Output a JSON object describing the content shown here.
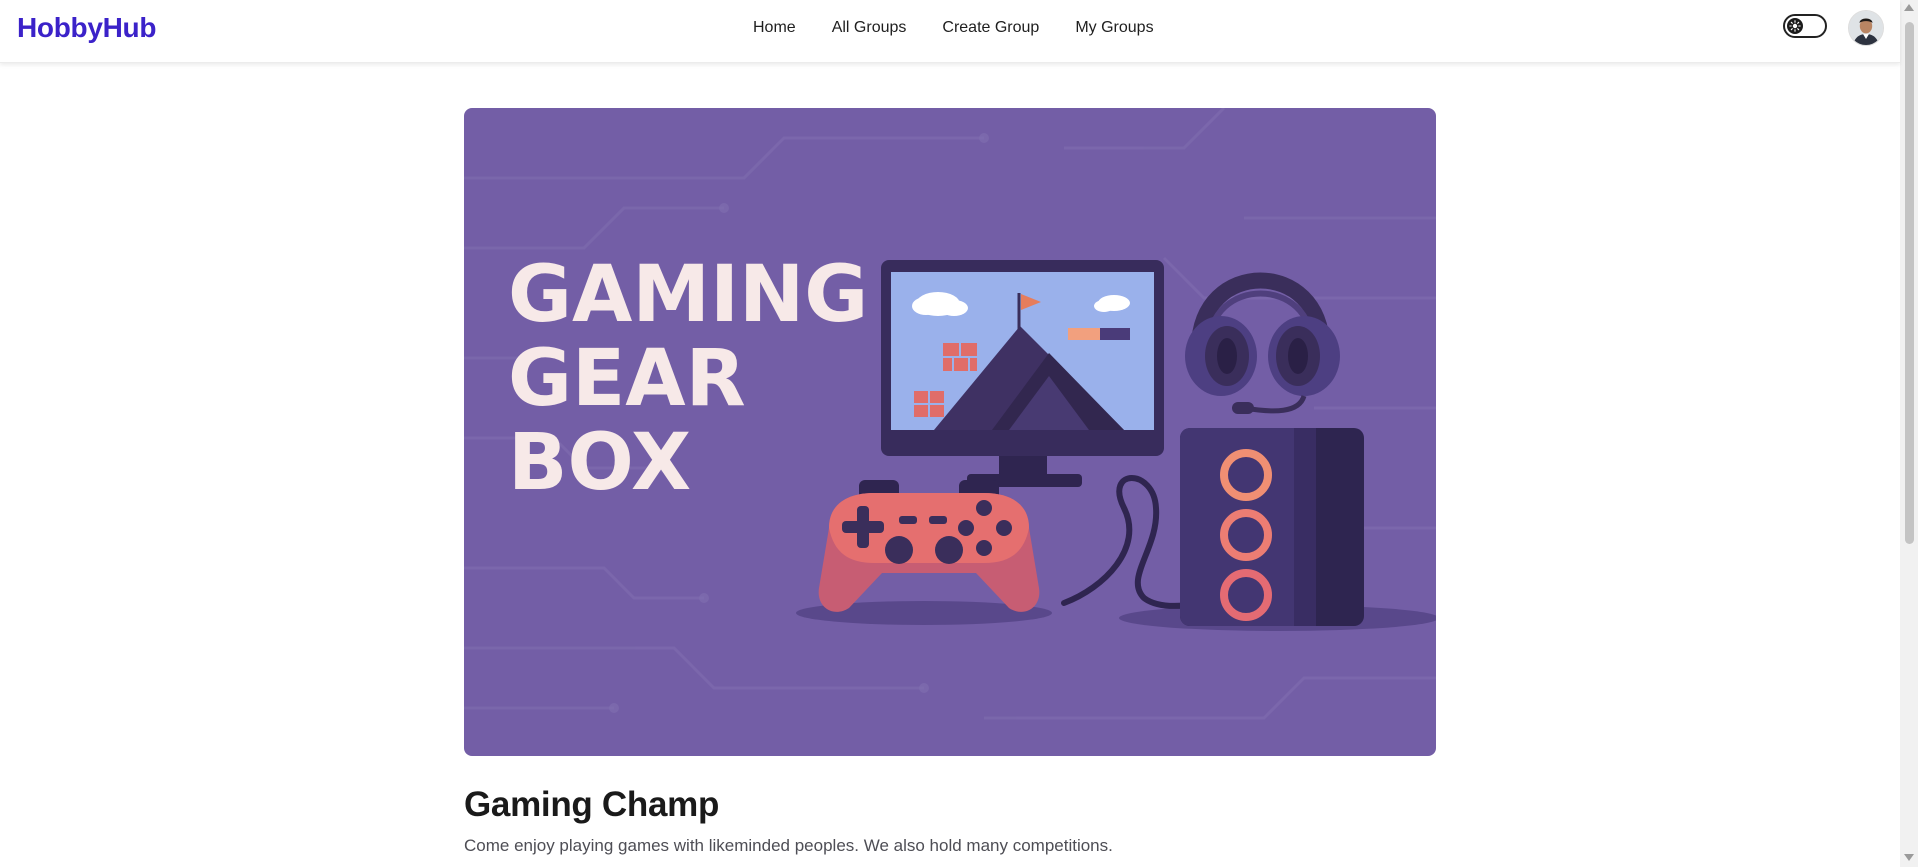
{
  "nav": {
    "brand": "HobbyHub",
    "links": [
      "Home",
      "All Groups",
      "Create Group",
      "My Groups"
    ]
  },
  "theme_toggle": {
    "icon": "sun-icon",
    "state": "off"
  },
  "user": {
    "avatar_icon": "user-avatar"
  },
  "hero": {
    "title_lines": [
      "GAMING",
      "GEAR",
      "BOX"
    ],
    "items": [
      "monitor-icon",
      "controller-icon",
      "headphones-icon",
      "speaker-icon"
    ]
  },
  "group": {
    "name": "Gaming Champ",
    "description": "Come enjoy playing games with likeminded peoples. We also hold many competitions."
  },
  "colors": {
    "brand": "#3b22c9",
    "hero_bg": "#735ea6",
    "hero_text": "#f7e9e8",
    "controller": "#e56f6f",
    "speaker_ring": "#f08f73"
  }
}
